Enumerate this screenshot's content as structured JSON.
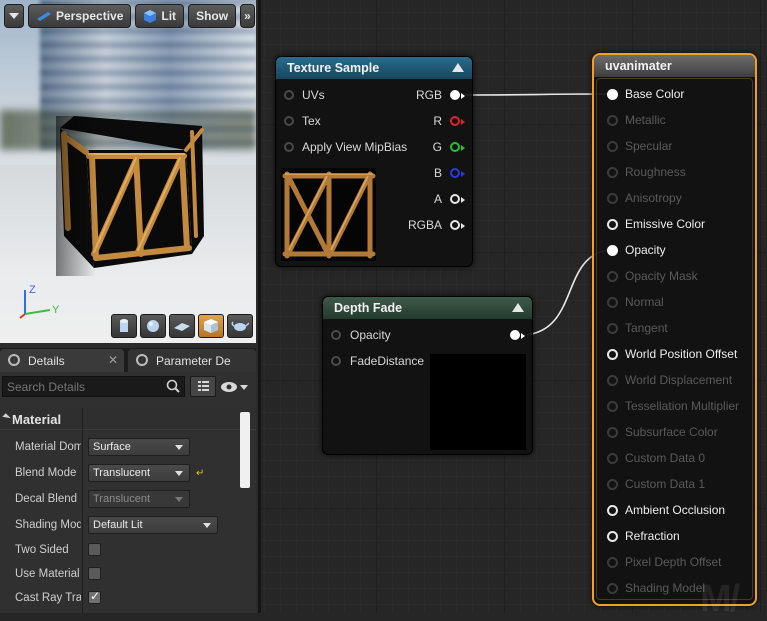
{
  "viewport": {
    "menu_label": "",
    "perspective_label": "Perspective",
    "lit_label": "Lit",
    "show_label": "Show",
    "more_label": "»",
    "axis_z": "Z",
    "axis_y": "Y",
    "shapes": [
      "cylinder-icon",
      "sphere-icon",
      "plane-icon",
      "cube-icon",
      "teapot-icon"
    ],
    "active_shape": "cube-icon"
  },
  "tabs": {
    "details": "Details",
    "params": "Parameter De"
  },
  "details": {
    "search_placeholder": "Search Details",
    "category": "Material",
    "properties": [
      {
        "label": "Material Dom",
        "type": "dropdown",
        "value": "Surface"
      },
      {
        "label": "Blend Mode",
        "type": "dropdown",
        "value": "Translucent"
      },
      {
        "label": "Decal Blend M",
        "type": "dropdown",
        "value": "Translucent",
        "disabled": true
      },
      {
        "label": "Shading Mod",
        "type": "dropdown",
        "value": "Default Lit"
      },
      {
        "label": "Two Sided",
        "type": "checkbox",
        "checked": false
      },
      {
        "label": "Use Material",
        "type": "checkbox",
        "checked": false
      },
      {
        "label": "Cast Ray Tra",
        "type": "checkbox",
        "checked": true
      }
    ],
    "reset_icon": "reset-arrow-icon"
  },
  "texture_sample": {
    "title": "Texture Sample",
    "inputs": [
      "UVs",
      "Tex",
      "Apply View MipBias"
    ],
    "outputs": [
      {
        "label": "RGB",
        "color": "#ffffff",
        "filled": true
      },
      {
        "label": "R",
        "color": "#e0232b",
        "filled": false
      },
      {
        "label": "G",
        "color": "#27c22b",
        "filled": false
      },
      {
        "label": "B",
        "color": "#2b3ae0",
        "filled": false
      },
      {
        "label": "A",
        "color": "#e6e6e6",
        "filled": false
      },
      {
        "label": "RGBA",
        "color": "#e6e6e6",
        "filled": false
      }
    ]
  },
  "depth_fade": {
    "title": "Depth Fade",
    "inputs": [
      "Opacity",
      "FadeDistance"
    ]
  },
  "result": {
    "title": "uvanimater",
    "pins": [
      {
        "label": "Base Color",
        "state": "connected"
      },
      {
        "label": "Metallic",
        "state": "disabled"
      },
      {
        "label": "Specular",
        "state": "disabled"
      },
      {
        "label": "Roughness",
        "state": "disabled"
      },
      {
        "label": "Anisotropy",
        "state": "disabled"
      },
      {
        "label": "Emissive Color",
        "state": "enabled"
      },
      {
        "label": "Opacity",
        "state": "connected"
      },
      {
        "label": "Opacity Mask",
        "state": "disabled"
      },
      {
        "label": "Normal",
        "state": "disabled"
      },
      {
        "label": "Tangent",
        "state": "disabled"
      },
      {
        "label": "World Position Offset",
        "state": "enabled"
      },
      {
        "label": "World Displacement",
        "state": "disabled"
      },
      {
        "label": "Tessellation Multiplier",
        "state": "disabled"
      },
      {
        "label": "Subsurface Color",
        "state": "disabled"
      },
      {
        "label": "Custom Data 0",
        "state": "disabled"
      },
      {
        "label": "Custom Data 1",
        "state": "disabled"
      },
      {
        "label": "Ambient Occlusion",
        "state": "enabled"
      },
      {
        "label": "Refraction",
        "state": "enabled"
      },
      {
        "label": "Pixel Depth Offset",
        "state": "disabled"
      },
      {
        "label": "Shading Model",
        "state": "disabled"
      }
    ]
  },
  "colors": {
    "selection": "#f0a020",
    "texture_header": "#1f5a78",
    "depth_header": "#2f4a3c"
  }
}
